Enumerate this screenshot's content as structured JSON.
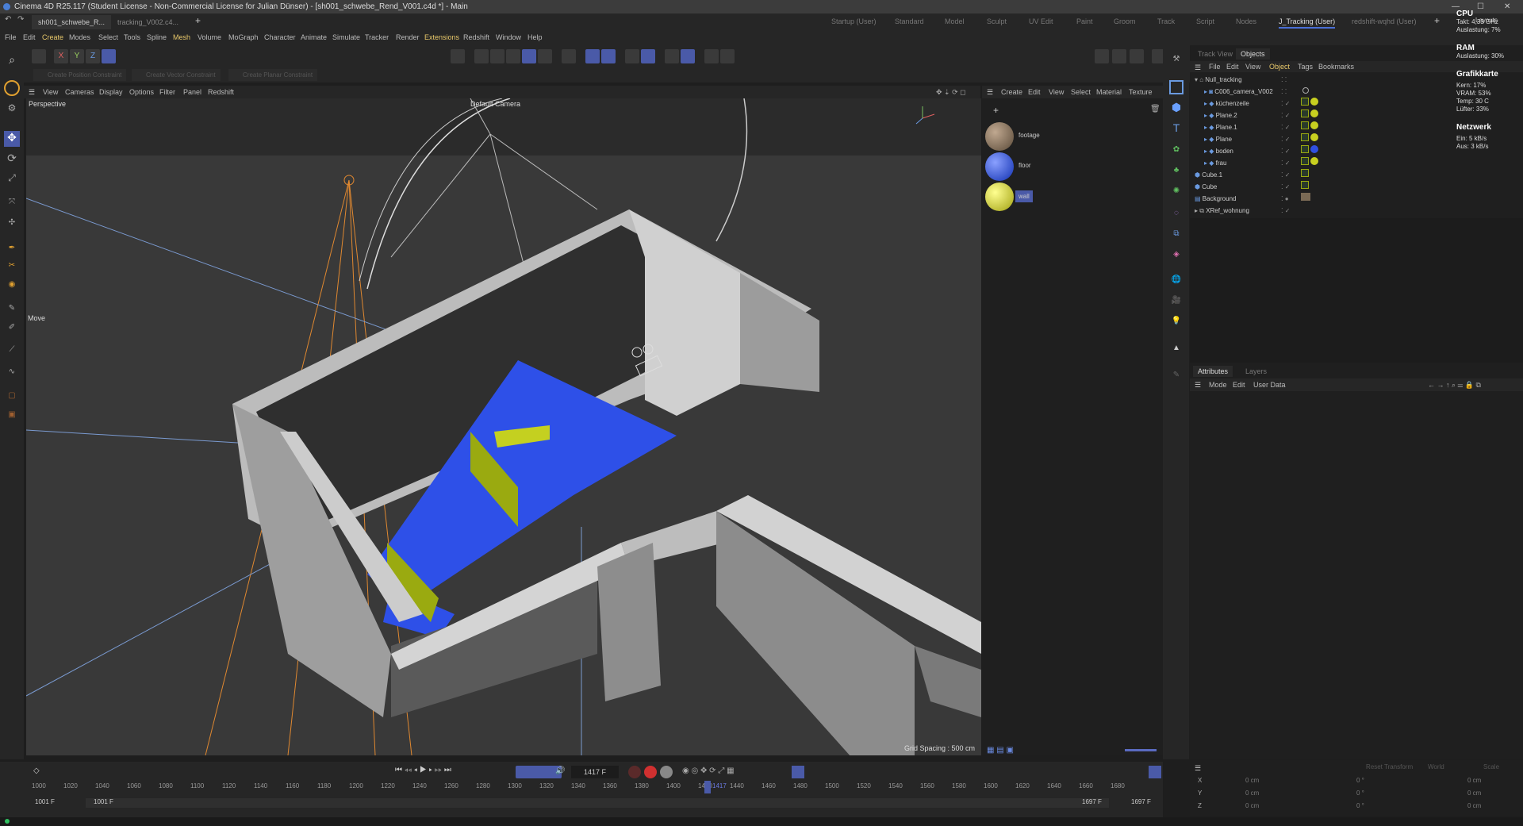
{
  "window_title": "Cinema 4D R25.117 (Student License - Non-Commercial License for Julian Dünser) - [sh001_schwebe_Rend_V001.c4d *] - Main",
  "doc_tabs": [
    "sh001_schwebe_R...",
    "tracking_V002.c4..."
  ],
  "layouts": [
    "Startup (User)",
    "Standard",
    "Model",
    "Sculpt",
    "UV Edit",
    "Paint",
    "Groom",
    "Track",
    "Script",
    "Nodes",
    "J_Tracking (User)",
    "redshift-wqhd (User)"
  ],
  "layouts_label": "Layouts",
  "menus": [
    "File",
    "Edit",
    "Create",
    "Modes",
    "Select",
    "Tools",
    "Spline",
    "Mesh",
    "Volume",
    "MoGraph",
    "Character",
    "Animate",
    "Simulate",
    "Tracker",
    "Render",
    "Extensions",
    "Redshift",
    "Window",
    "Help"
  ],
  "constraints": [
    "Create Position Constraint",
    "Create Vector Constraint",
    "Create Planar Constraint"
  ],
  "axes": [
    "X",
    "Y",
    "Z"
  ],
  "viewport": {
    "menus": [
      "View",
      "Cameras",
      "Display",
      "Options",
      "Filter",
      "Panel",
      "Redshift"
    ],
    "view_name": "Perspective",
    "camera": "Default Camera",
    "grid": "Grid Spacing : 500 cm",
    "tool": "Move"
  },
  "materials": {
    "menus": [
      "Create",
      "Edit",
      "View",
      "Select",
      "Material",
      "Texture"
    ],
    "items": [
      {
        "name": "footage",
        "color": "#7a6a55"
      },
      {
        "name": "floor",
        "color": "#2a4fd8"
      },
      {
        "name": "wall",
        "color": "#d8de30"
      }
    ]
  },
  "objects_panel": {
    "tabs": [
      "Track View",
      "Objects"
    ],
    "menus": [
      "File",
      "Edit",
      "View",
      "Object",
      "Tags",
      "Bookmarks"
    ],
    "items": [
      {
        "name": "Null_tracking",
        "indent": 0
      },
      {
        "name": "C006_camera_V002",
        "indent": 1
      },
      {
        "name": "küchenzeile",
        "indent": 1
      },
      {
        "name": "Plane.2",
        "indent": 1
      },
      {
        "name": "Plane.1",
        "indent": 1
      },
      {
        "name": "Plane",
        "indent": 1
      },
      {
        "name": "boden",
        "indent": 1
      },
      {
        "name": "frau",
        "indent": 1
      },
      {
        "name": "Cube.1",
        "indent": 0
      },
      {
        "name": "Cube",
        "indent": 0
      },
      {
        "name": "Background",
        "indent": 0
      },
      {
        "name": "XRef_wohnung",
        "indent": 0
      }
    ]
  },
  "attributes": {
    "tabs": [
      "Attributes",
      "Layers"
    ],
    "menus": [
      "Mode",
      "Edit",
      "User Data"
    ]
  },
  "coords": {
    "header": [
      "Reset Transform",
      "World",
      "Scale"
    ],
    "rows": [
      {
        "axis": "X",
        "pos": "0 cm",
        "rot": "0 °",
        "scale": "0 cm"
      },
      {
        "axis": "Y",
        "pos": "0 cm",
        "rot": "0 °",
        "scale": "0 cm"
      },
      {
        "axis": "Z",
        "pos": "0 cm",
        "rot": "0 °",
        "scale": "0 cm"
      }
    ]
  },
  "timeline": {
    "frame_field": "1417 F",
    "start": "1001 F",
    "start2": "1001 F",
    "end": "1697 F",
    "end2": "1697 F",
    "current": "1417",
    "ticks": [
      "1000",
      "1020",
      "1040",
      "1060",
      "1080",
      "1100",
      "1120",
      "1140",
      "1160",
      "1180",
      "1200",
      "1220",
      "1240",
      "1260",
      "1280",
      "1300",
      "1320",
      "1340",
      "1360",
      "1380",
      "1400",
      "1420",
      "1440",
      "1460",
      "1480",
      "1500",
      "1520",
      "1540",
      "1560",
      "1580",
      "1600",
      "1620",
      "1640",
      "1660",
      "1680"
    ]
  },
  "perf": {
    "cpu": "CPU",
    "cpu_clock": "Takt: 4,33 GHz",
    "cpu_load": "Auslastung: 7%",
    "ram": "RAM",
    "ram_load": "Auslastung: 30%",
    "gpu": "Grafikkarte",
    "gpu_core": "Kern: 17%",
    "gpu_vram": "VRAM: 53%",
    "gpu_temp": "Temp: 30 C",
    "gpu_fan": "Lüfter: 33%",
    "net": "Netzwerk",
    "net_in": "Ein: 5 kB/s",
    "net_out": "Aus: 3 kB/s"
  }
}
